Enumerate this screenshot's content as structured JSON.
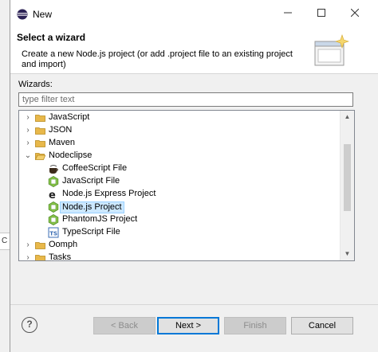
{
  "window": {
    "title": "New"
  },
  "header": {
    "title": "Select a wizard",
    "description": "Create a new Node.js project (or add .project file to an existing project and import)"
  },
  "wizards": {
    "label": "Wizards:",
    "filter_placeholder": "type filter text",
    "tree": [
      {
        "label": "JavaScript",
        "expanded": false,
        "depth": 0,
        "type": "folder"
      },
      {
        "label": "JSON",
        "expanded": false,
        "depth": 0,
        "type": "folder"
      },
      {
        "label": "Maven",
        "expanded": false,
        "depth": 0,
        "type": "folder"
      },
      {
        "label": "Nodeclipse",
        "expanded": true,
        "depth": 0,
        "type": "folder"
      },
      {
        "label": "CoffeeScript File",
        "depth": 1,
        "icon": "coffee-icon"
      },
      {
        "label": "JavaScript File",
        "depth": 1,
        "icon": "js-file-icon"
      },
      {
        "label": "Node.js Express Project",
        "depth": 1,
        "icon": "express-icon"
      },
      {
        "label": "Node.js Project",
        "depth": 1,
        "icon": "nodejs-icon",
        "selected": true
      },
      {
        "label": "PhantomJS Project",
        "depth": 1,
        "icon": "phantomjs-icon"
      },
      {
        "label": "TypeScript File",
        "depth": 1,
        "icon": "typescript-icon"
      },
      {
        "label": "Oomph",
        "expanded": false,
        "depth": 0,
        "type": "folder"
      },
      {
        "label": "Tasks",
        "expanded": false,
        "depth": 0,
        "type": "folder"
      }
    ]
  },
  "buttons": {
    "help": "?",
    "back": "< Back",
    "next": "Next >",
    "finish": "Finish",
    "cancel": "Cancel"
  },
  "background": {
    "fragment": "C"
  },
  "colors": {
    "selection": "#cce8ff",
    "accent": "#0078d7",
    "folder": "#e8b84a"
  }
}
